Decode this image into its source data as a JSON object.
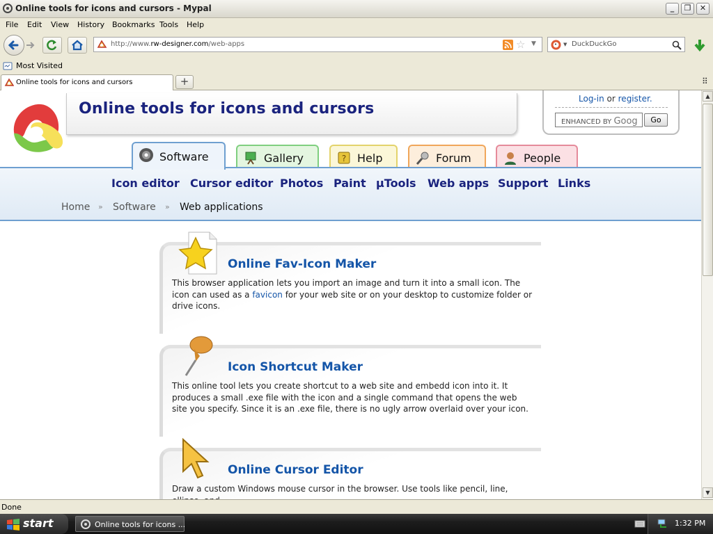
{
  "window": {
    "title": "Online tools for icons and cursors - Mypal"
  },
  "menu": [
    "File",
    "Edit",
    "View",
    "History",
    "Bookmarks",
    "Tools",
    "Help"
  ],
  "address": {
    "prefix": "http://www.",
    "domain": "rw-designer.com",
    "path": "/web-apps"
  },
  "search_engine": {
    "placeholder": "DuckDuckGo"
  },
  "bookmarks": {
    "most_visited": "Most Visited"
  },
  "browser_tab": {
    "title": "Online tools for icons and cursors",
    "new_tab": "+"
  },
  "site": {
    "title": "Online tools for icons and cursors",
    "login": {
      "login": "Log-in",
      "or": "or",
      "register": "register."
    },
    "search": {
      "enhanced": "ENHANCED BY",
      "google": "Goog",
      "go": "Go"
    },
    "tabs": [
      "Software",
      "Gallery",
      "Help",
      "Forum",
      "People"
    ],
    "subnav": [
      "Icon editor",
      "Cursor editor",
      "Photos",
      "Paint",
      "µTools",
      "Web apps",
      "Support",
      "Links"
    ],
    "breadcrumb": [
      "Home",
      "Software",
      "Web applications"
    ],
    "crumb_sep": "»",
    "cards": [
      {
        "title": "Online Fav-Icon Maker",
        "desc_before": "This browser application lets you import an image and turn it into a small icon. The icon can used as a ",
        "desc_link": "favicon",
        "desc_after": " for your web site or on your desktop to customize folder or drive icons."
      },
      {
        "title": "Icon Shortcut Maker",
        "desc": "This online tool lets you create shortcut to a web site and embedd icon into it. It produces a small .exe file with the icon and a single command that opens the web site you specify. Since it is an .exe file, there is no ugly arrow overlaid over your icon."
      },
      {
        "title": "Online Cursor Editor",
        "desc": "Draw a custom Windows mouse cursor in the browser. Use tools like pencil, line, ellipse, and"
      }
    ]
  },
  "status": "Done",
  "taskbar": {
    "start": "start",
    "task": "Online tools for icons ...",
    "clock": "1:32 PM"
  },
  "colors": {
    "accent": "#1455a8",
    "title": "#1a237e",
    "tab_border": "#6e9fd0"
  }
}
